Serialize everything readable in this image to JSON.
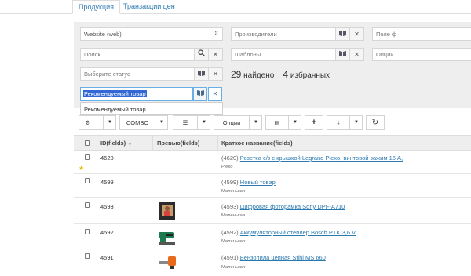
{
  "tabs": [
    "Продукция",
    "Транзакции цен"
  ],
  "filters": {
    "site": "Website (web)",
    "manufacturers": "Производители",
    "field_prefix": "Поле ф",
    "search": "Поиск",
    "templates": "Шаблоны",
    "options": "Опции",
    "status": "Выберите статус",
    "found_count": "29",
    "found_label": "найдено",
    "fav_count": "4",
    "fav_label": "избранных",
    "autocomplete_value": "Рекомендуемый товар",
    "autocomplete_option": "Рекомендуемый товар"
  },
  "toolbar": {
    "combo_label": "COMBO",
    "options_label": "Опции"
  },
  "table": {
    "headers": [
      "ID(fields)",
      "Превью(fields)",
      "Краткое название(fields)"
    ],
    "sort_mark": "⌄",
    "rows": [
      {
        "id": "4620",
        "num": "(4620)",
        "title": "Розетка с/з с крышкой Legrand Plexo, винтовой зажим 16 A,",
        "sub": "Plexo",
        "starred": true
      },
      {
        "id": "4599",
        "num": "(4599)",
        "title": "Новый товар",
        "sub": "Маленькая",
        "starred": false
      },
      {
        "id": "4593",
        "num": "(4593)",
        "title": "Цифровая фоторамка Sony DPF-A710",
        "sub": "Маленькая",
        "starred": false
      },
      {
        "id": "4592",
        "num": "(4592)",
        "title": "Аккумуляторный степлер Bosch PTK 3,6 V",
        "sub": "Маленькая",
        "starred": false
      },
      {
        "id": "4591",
        "num": "(4591)",
        "title": "Бензопила цепная Stihl MS 660",
        "sub": "Маленькая",
        "starred": false
      }
    ]
  },
  "colors": {
    "link": "#2a7ab0",
    "panel_bg": "#eeeeee",
    "highlight": "#3367d6"
  }
}
